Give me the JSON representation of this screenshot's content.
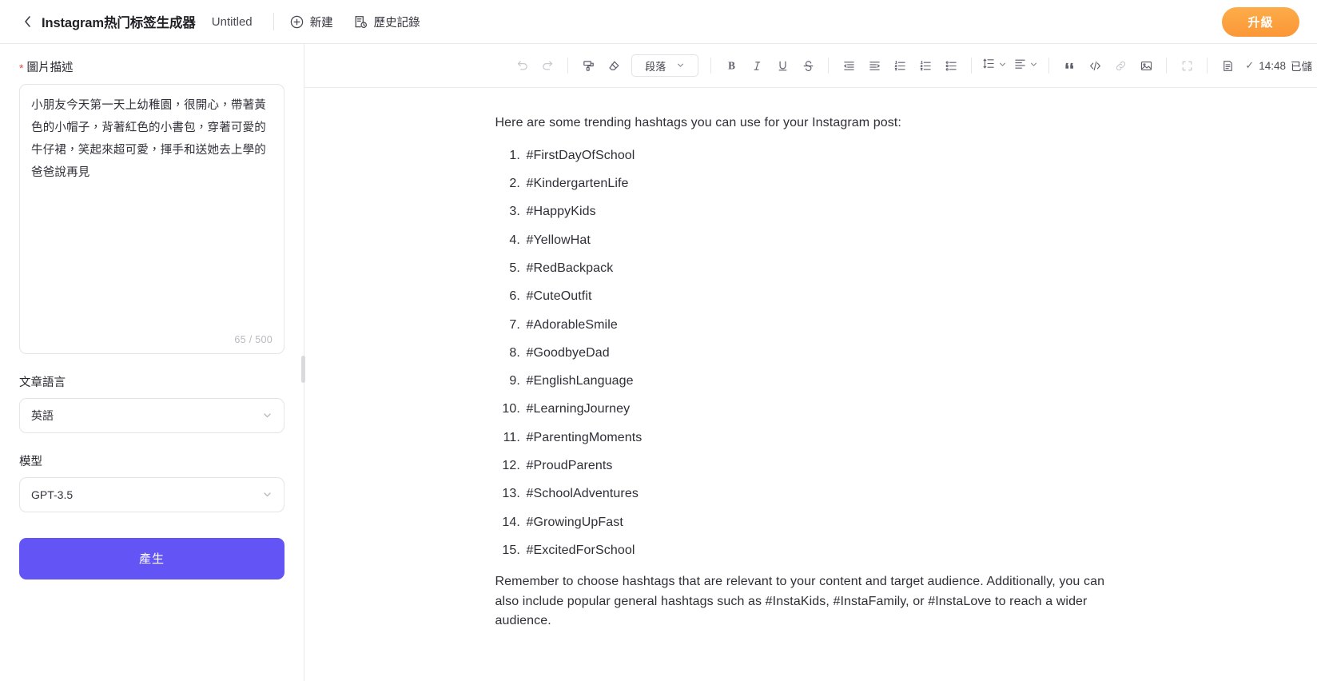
{
  "header": {
    "back_icon": "chevron-left-icon",
    "app_title": "Instagram热门标签生成器",
    "doc_title": "Untitled",
    "new_label": "新建",
    "history_label": "歷史記錄",
    "upgrade_label": "升級",
    "upgrade_color": "#fb9636"
  },
  "left_panel": {
    "image_desc_label": "圖片描述",
    "required_mark": "*",
    "image_desc_value": "小朋友今天第一天上幼稚園，很開心，帶著黃色的小帽子，背著紅色的小書包，穿著可愛的牛仔裙，笑起來超可愛，揮手和送她去上學的爸爸說再見",
    "char_count": "65 / 500",
    "language_label": "文章語言",
    "language_value": "英語",
    "model_label": "模型",
    "model_value": "GPT-3.5",
    "generate_label": "產生",
    "generate_color": "#6355f5"
  },
  "toolbar": {
    "undo": "undo-icon",
    "redo": "redo-icon",
    "format_painter": "format-painter-icon",
    "clear_format": "eraser-icon",
    "block_type": "段落",
    "bold": "B",
    "italic": "I",
    "underline": "U",
    "strikethrough": "S",
    "outdent": "outdent-icon",
    "indent": "indent-icon",
    "ordered_list": "ordered-list-icon",
    "ordered_list_2": "ordered-list-alt-icon",
    "bullet_list": "bullet-list-icon",
    "line_height": "line-height-icon",
    "align": "align-icon",
    "quote": "quote-icon",
    "code": "code-icon",
    "link": "link-icon",
    "image": "image-icon",
    "fullscreen": "fullscreen-icon",
    "document": "document-icon",
    "save_check": "✓",
    "save_time": "14:48",
    "save_text": "已儲"
  },
  "editor": {
    "intro": "Here are some trending hashtags you can use for your Instagram post:",
    "hashtags": [
      "#FirstDayOfSchool",
      "#KindergartenLife",
      "#HappyKids",
      "#YellowHat",
      "#RedBackpack",
      "#CuteOutfit",
      "#AdorableSmile",
      "#GoodbyeDad",
      "#EnglishLanguage",
      "#LearningJourney",
      "#ParentingMoments",
      "#ProudParents",
      "#SchoolAdventures",
      "#GrowingUpFast",
      "#ExcitedForSchool"
    ],
    "outro": "Remember to choose hashtags that are relevant to your content and target audience. Additionally, you can also include popular general hashtags such as #InstaKids, #InstaFamily, or #InstaLove to reach a wider audience."
  }
}
